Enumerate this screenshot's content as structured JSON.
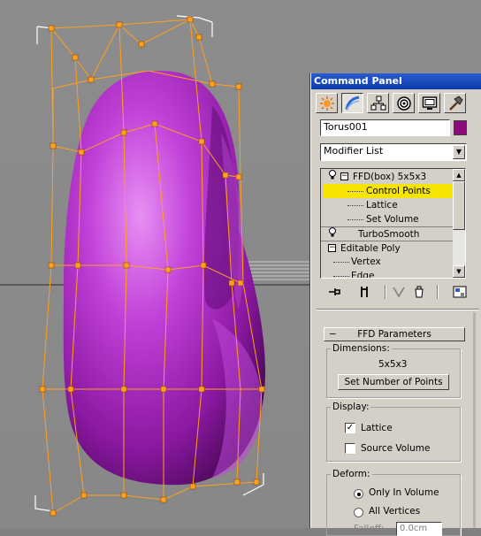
{
  "panel": {
    "title": "Command Panel",
    "tabs": [
      {
        "name": "create-tab",
        "icon": "sun-icon"
      },
      {
        "name": "modify-tab",
        "icon": "modify-arc-icon"
      },
      {
        "name": "hierarchy-tab",
        "icon": "hierarchy-icon"
      },
      {
        "name": "motion-tab",
        "icon": "motion-icon"
      },
      {
        "name": "display-tab",
        "icon": "monitor-icon"
      },
      {
        "name": "utilities-tab",
        "icon": "hammer-icon"
      }
    ],
    "object_name": "Torus001",
    "object_color": "#8a0a7c",
    "modifier_list": "Modifier List",
    "stack": [
      {
        "label": "FFD(box) 5x5x3",
        "kind": "modifier",
        "expanded": true
      },
      {
        "label": "Control Points",
        "kind": "sub",
        "selected": true
      },
      {
        "label": "Lattice",
        "kind": "sub"
      },
      {
        "label": "Set Volume",
        "kind": "sub"
      },
      {
        "label": "TurboSmooth",
        "kind": "modifier"
      },
      {
        "label": "Editable Poly",
        "kind": "base",
        "expanded": true
      },
      {
        "label": "Vertex",
        "kind": "sub"
      },
      {
        "label": "Edge",
        "kind": "sub"
      }
    ],
    "selection_color": "#f7e400",
    "ffd": {
      "rollout_title": "FFD Parameters",
      "rollout_toggle": "−",
      "dimensions_label": "Dimensions:",
      "dimensions_value": "5x5x3",
      "set_points_button": "Set Number of Points",
      "display_label": "Display:",
      "lattice_label": "Lattice",
      "lattice_checked": true,
      "source_volume_label": "Source Volume",
      "source_volume_checked": false,
      "deform_label": "Deform:",
      "only_in_volume_label": "Only In Volume",
      "all_vertices_label": "All Vertices",
      "falloff_label": "Falloff:",
      "falloff_value": "0.0cm"
    }
  },
  "viewport": {
    "object_color": "#a020b0",
    "lattice_color": "#ffa020"
  }
}
